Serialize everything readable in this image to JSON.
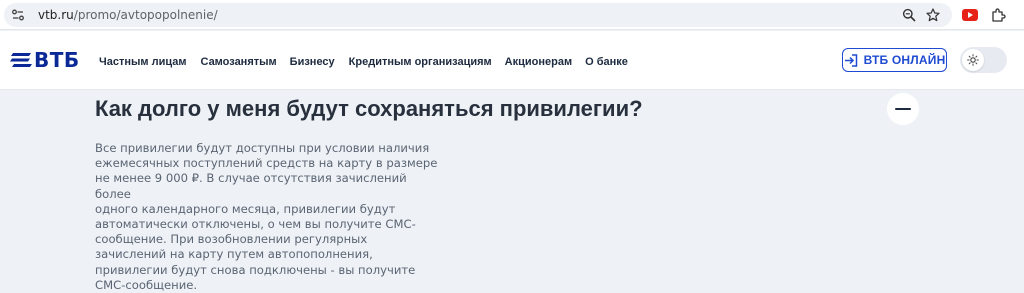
{
  "browser": {
    "url_host": "vtb.ru",
    "url_path": "/promo/avtopopolnenie/",
    "icons": [
      "site-info-icon",
      "zoom-icon",
      "bookmark-star-icon",
      "youtube-extension-icon",
      "extensions-puzzle-icon"
    ]
  },
  "header": {
    "logo_text": "ВТБ",
    "nav": [
      "Частным лицам",
      "Самозанятым",
      "Бизнесу",
      "Кредитным организациям",
      "Акционерам",
      "О банке"
    ],
    "login_label": "ВТБ ОНЛАЙН",
    "brand_color": "#0a2896",
    "accent_color": "#1e4bd2"
  },
  "faq": {
    "question": "Как долго у меня будут сохраняться привилегии?",
    "answer_lines": [
      "Все привилегии будут доступны при условии наличия",
      "ежемесячных поступлений средств на карту в размере",
      "не менее 9 000 ₽. В случае отсутствия зачислений более",
      "одного календарного месяца, привилегии будут",
      "автоматически отключены, о чем вы получите СМС-",
      "сообщение. При возобновлении регулярных",
      "зачислений на карту путем автопополнения,",
      "привилегии будут снова подключены - вы получите",
      "СМС-сообщение."
    ],
    "expanded": true
  }
}
